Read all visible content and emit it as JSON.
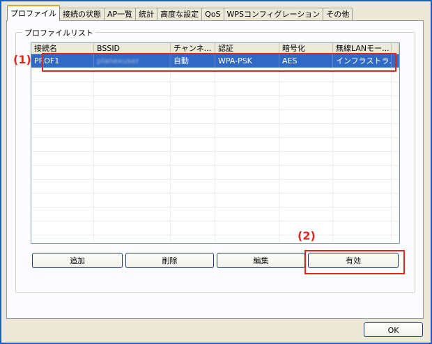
{
  "tabs": [
    "プロファイル",
    "接続の状態",
    "AP一覧",
    "統計",
    "高度な設定",
    "QoS",
    "WPSコンフィグレーション",
    "その他"
  ],
  "active_tab": 0,
  "group_title": "プロファイルリスト",
  "list": {
    "columns": [
      "接続名",
      "BSSID",
      "チャンネ...",
      "認証",
      "暗号化",
      "無線LANモー..."
    ],
    "rows": [
      [
        "PROF1",
        "planexuser",
        "自動",
        "WPA-PSK",
        "AES",
        "インフラストラ..."
      ]
    ]
  },
  "buttons": {
    "add": "追加",
    "delete": "削除",
    "edit": "編集",
    "activate": "有効",
    "ok": "OK"
  },
  "annotations": {
    "label1": "(1)",
    "label2": "(2)",
    "color": "#e8231c"
  }
}
